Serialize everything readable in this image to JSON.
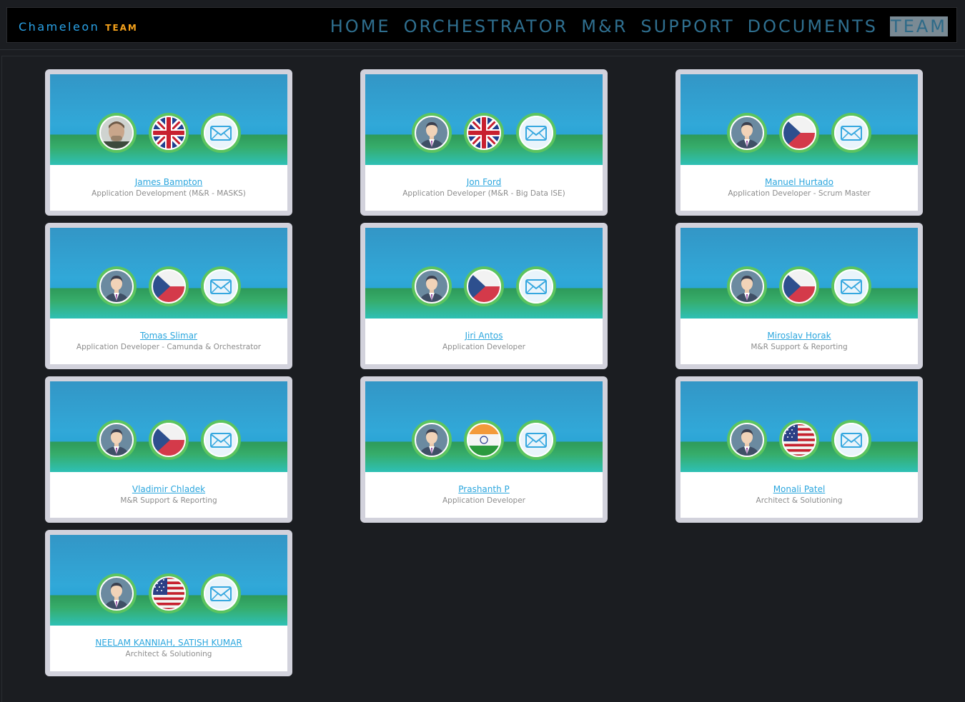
{
  "brand": {
    "name": "Chameleon",
    "sub": "TEAM"
  },
  "nav": [
    {
      "label": "HOME"
    },
    {
      "label": "ORCHESTRATOR"
    },
    {
      "label": "M&R"
    },
    {
      "label": "SUPPORT"
    },
    {
      "label": "DOCUMENTS"
    },
    {
      "label": "TEAM",
      "active": true
    }
  ],
  "team": [
    {
      "name": "James Bampton",
      "role": "Application Development (M&R - MASKS)",
      "flag": "uk",
      "avatar": "photo"
    },
    {
      "name": "Jon Ford",
      "role": "Application Developer (M&R - Big Data ISE)",
      "flag": "uk",
      "avatar": "default"
    },
    {
      "name": "Manuel Hurtado",
      "role": "Application Developer - Scrum Master",
      "flag": "cz",
      "avatar": "default"
    },
    {
      "name": "Tomas Slimar",
      "role": "Application Developer - Camunda & Orchestrator",
      "flag": "cz",
      "avatar": "default"
    },
    {
      "name": "Jiri Antos",
      "role": "Application Developer",
      "flag": "cz",
      "avatar": "default"
    },
    {
      "name": "Miroslav Horak",
      "role": "M&R Support & Reporting",
      "flag": "cz",
      "avatar": "default"
    },
    {
      "name": "Vladimir Chladek",
      "role": "M&R Support & Reporting",
      "flag": "cz",
      "avatar": "default"
    },
    {
      "name": "Prashanth P",
      "role": "Application Developer",
      "flag": "in",
      "avatar": "default"
    },
    {
      "name": "Monali Patel",
      "role": "Architect & Solutioning",
      "flag": "us",
      "avatar": "default"
    },
    {
      "name": "NEELAM KANNIAH, SATISH KUMAR",
      "role": "Architect & Solutioning",
      "flag": "us",
      "avatar": "default"
    }
  ]
}
